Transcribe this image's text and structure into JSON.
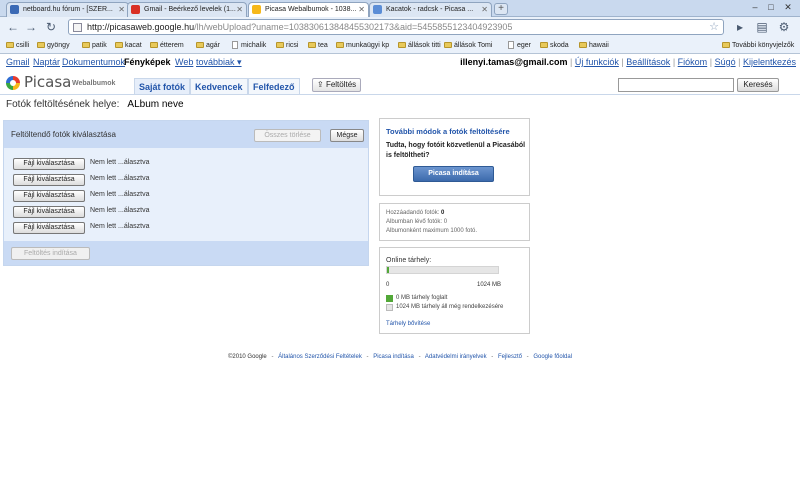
{
  "browser": {
    "tabs": [
      {
        "title": "netboard.hu fórum - [SZER...",
        "favicon_color": "#3b6ab5"
      },
      {
        "title": "Gmail - Beérkező levelek (1...",
        "favicon_color": "#d93025"
      },
      {
        "title": "Picasa Webalbumok - 1038...",
        "favicon_color": "#f6b81a"
      },
      {
        "title": "Kacatok - radcsk - Picasa ...",
        "favicon_color": "#5b8dd6"
      }
    ],
    "new_tab_label": "+",
    "window_controls": [
      "–",
      "□",
      "✕"
    ],
    "url_host": "http://picasaweb.google.hu",
    "url_path": "/lh/webUpload?uname=103830613848455302173&aid=5455855123404923905",
    "bookmarks": [
      "csilli",
      "gyöngy",
      "patik",
      "kacat",
      "étterem",
      "agár",
      "michalik",
      "ricsi",
      "tea",
      "munkaügyi kp",
      "állások titti",
      "állások Tomi",
      "eger",
      "skoda",
      "hawaii"
    ],
    "other_bookmarks": "További könyvjelzők"
  },
  "gbar": {
    "links": [
      "Gmail",
      "Naptár",
      "Dokumentumok"
    ],
    "current": "Fényképek",
    "links2": [
      "Web",
      "továbbiak ▾"
    ],
    "user": "illenyi.tamas@gmail.com",
    "right_links": [
      "Új funkciók",
      "Beállítások",
      "Fiókom",
      "Súgó",
      "Kijelentkezés"
    ]
  },
  "header": {
    "logo_word": "Picasa",
    "logo_sub": "Webalbumok",
    "tabs": [
      "Saját fotók",
      "Kedvencek",
      "Felfedező"
    ],
    "upload_label": "Feltöltés",
    "search_label": "Keresés"
  },
  "page": {
    "title_label": "Fotók feltöltésének helye:",
    "album_name": "ALbum neve"
  },
  "upload": {
    "header_label": "Feltöltendő fotók kiválasztása",
    "clear_all": "Összes törlése",
    "cancel": "Mégse",
    "file_button": "Fájl kiválasztása",
    "file_status": "Nem lett ...álasztva",
    "file_rows": 5,
    "start_upload": "Feltöltés indítása"
  },
  "sidebar": {
    "more_title": "További módok a fotók feltöltésére",
    "more_text": "Tudta, hogy fotóit közvetlenül a Picasából is feltöltheti?",
    "picasa_button": "Picasa indítása",
    "stats": [
      {
        "label": "Hozzáadandó fotók:",
        "value": "0"
      },
      {
        "label": "Albumban lévő fotók:",
        "value": "0"
      },
      {
        "label": "Albumonként maximum 1000 fotó.",
        "value": ""
      }
    ],
    "storage_label": "Online tárhely:",
    "storage_used_fraction": 0.005,
    "storage_min": "0",
    "storage_max": "1024 MB",
    "legend": [
      {
        "text": "0 MB tárhely foglalt",
        "color": "#52a838"
      },
      {
        "text": "1024 MB tárhely áll még rendelkezésére",
        "color": "#e6e6e6"
      }
    ],
    "expand_link": "Tárhely bővítése"
  },
  "footer": {
    "copyright": "©2010 Google",
    "links": [
      "Általános Szerződési Feltételek",
      "Picasa indítása",
      "Adatvédelmi irányelvek",
      "Fejlesztő",
      "Google főoldal"
    ]
  }
}
